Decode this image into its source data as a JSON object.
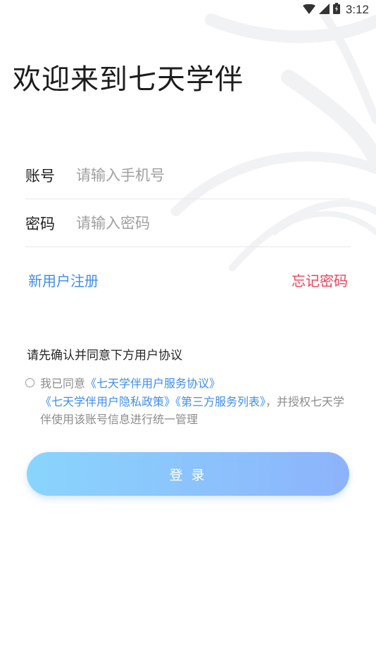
{
  "status_bar": {
    "time": "3:12",
    "icons": [
      "wifi-icon",
      "signal-icon",
      "battery-icon"
    ]
  },
  "title": "欢迎来到七天学伴",
  "account": {
    "label": "账号",
    "placeholder": "请输入手机号",
    "value": ""
  },
  "password": {
    "label": "密码",
    "placeholder": "请输入密码",
    "value": ""
  },
  "links": {
    "register": "新用户注册",
    "forgot": "忘记密码"
  },
  "agreement": {
    "title": "请先确认并同意下方用户协议",
    "checked": false,
    "prefix": "我已同意",
    "user_agreement": "《七天学伴用户服务协议》",
    "privacy_policy": "《七天学伴用户隐私政策》",
    "third_party_list": "《第三方服务列表》",
    "suffix": "，并授权七天学伴使用该账号信息进行统一管理"
  },
  "login_button": "登 录",
  "colors": {
    "link_blue": "#3f8ee8",
    "forgot_red": "#e8435a",
    "button_gradient_start": "#89d5fd",
    "button_gradient_end": "#8db3fb"
  }
}
